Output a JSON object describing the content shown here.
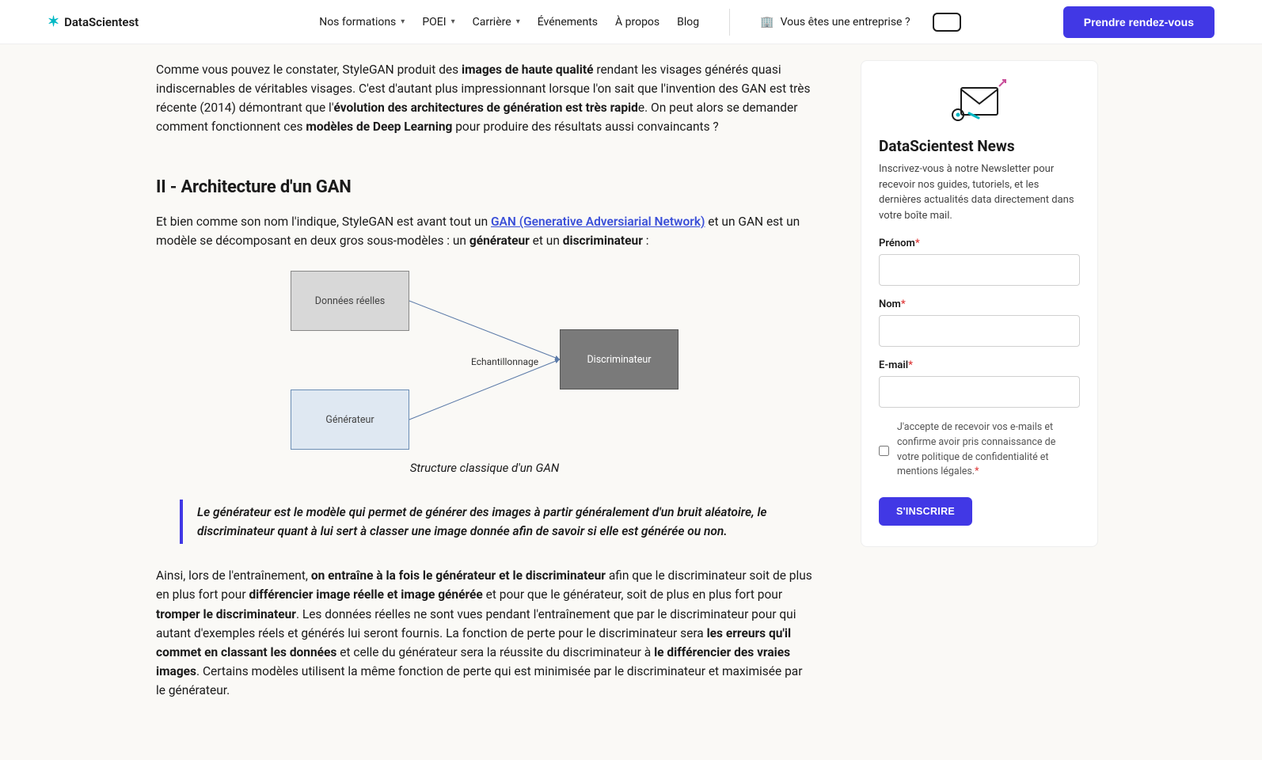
{
  "header": {
    "brand": "DataScientest",
    "nav": {
      "formations": "Nos formations",
      "poei": "POEI",
      "carriere": "Carrière",
      "evenements": "Événements",
      "apropos": "À propos",
      "blog": "Blog"
    },
    "enterprise": "Vous êtes une entreprise ?",
    "cta": "Prendre rendez-vous"
  },
  "article": {
    "p1_a": "Comme vous pouvez le constater, StyleGAN produit des ",
    "p1_b": "images de haute qualité",
    "p1_c": " rendant les visages générés quasi indiscernables de véritables visages. C'est d'autant plus impressionnant lorsque l'on sait que l'invention des GAN est très récente (2014) démontrant que l'",
    "p1_d": "évolution des architectures de génération est très rapid",
    "p1_e": "e. On peut alors se demander comment fonctionnent ces ",
    "p1_f": "modèles de Deep Learning",
    "p1_g": " pour produire des résultats aussi convaincants ?",
    "h2": "II - Architecture d'un GAN",
    "p2_a": "Et bien comme son nom l'indique, StyleGAN est avant tout un ",
    "p2_link": "GAN (Generative Adversiarial Network)",
    "p2_b": " et un GAN est un modèle se décomposant en deux gros sous-modèles : un ",
    "p2_c": "générateur",
    "p2_d": " et un ",
    "p2_e": "discriminateur",
    "p2_f": " :",
    "diagram": {
      "real": "Données réelles",
      "gen": "Générateur",
      "disc": "Discriminateur",
      "sampling": "Echantillonnage"
    },
    "caption": "Structure classique d'un GAN",
    "quote": "Le générateur est le modèle qui permet de générer des images à partir généralement d'un bruit aléatoire, le discriminateur quant à lui sert à classer une image donnée afin de savoir si elle est générée ou non.",
    "p3_a": "Ainsi, lors de l'entraînement, ",
    "p3_b": "on entraîne à la fois le générateur et le discriminateur",
    "p3_c": " afin que le discriminateur soit de plus en plus fort pour ",
    "p3_d": "différencier image réelle et image générée",
    "p3_e": " et pour que le générateur, soit de plus en plus fort pour ",
    "p3_f": "tromper le discriminateur",
    "p3_g": ". Les données réelles ne sont vues pendant l'entraînement que par le discriminateur pour qui autant d'exemples réels et générés lui seront fournis. La fonction de perte pour le discriminateur sera ",
    "p3_h": "les erreurs qu'il commet en classant les données",
    "p3_i": " et celle du générateur sera la réussite du discriminateur à ",
    "p3_j": "le différencier des vraies images",
    "p3_k": ". Certains modèles utilisent la même fonction de perte qui est minimisée par le discriminateur et maximisée par le générateur."
  },
  "sidebar": {
    "title": "DataScientest News",
    "desc": "Inscrivez-vous à notre Newsletter pour recevoir nos guides, tutoriels, et les dernières actualités data directement dans votre boîte mail.",
    "firstname": "Prénom",
    "lastname": "Nom",
    "email": "E-mail",
    "consent": "J'accepte de recevoir vos e-mails et confirme avoir pris connaissance de votre politique de confidentialité et mentions légales.",
    "submit": "S'INSCRIRE"
  }
}
